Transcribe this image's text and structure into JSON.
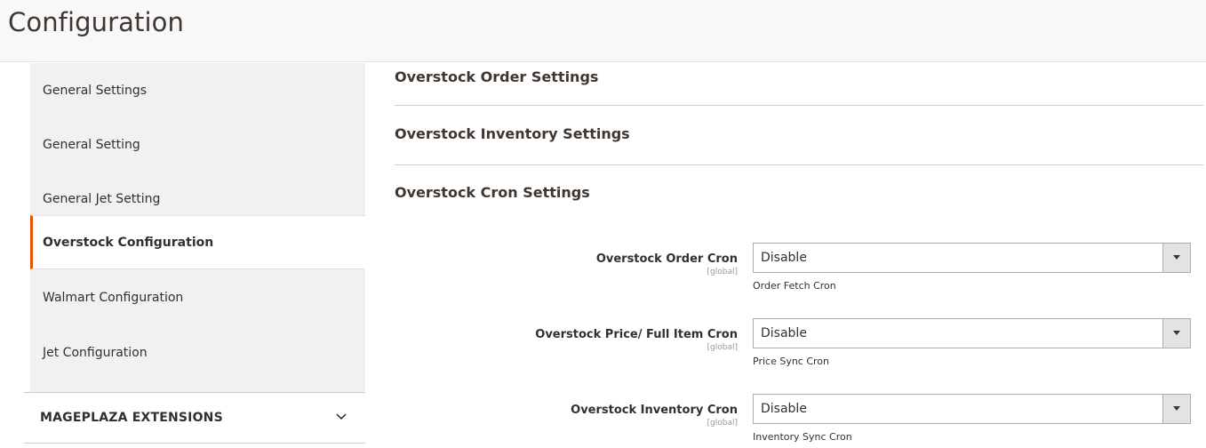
{
  "header": {
    "title": "Configuration"
  },
  "sidebar": {
    "items": [
      {
        "label": "General Settings"
      },
      {
        "label": "General Setting"
      },
      {
        "label": "General Jet Setting"
      },
      {
        "label": "Overstock Configuration",
        "active": true
      },
      {
        "label": "Walmart Configuration"
      },
      {
        "label": "Jet Configuration"
      }
    ],
    "section": {
      "label": "MAGEPLAZA EXTENSIONS",
      "icon": "chevron-down-icon"
    }
  },
  "main": {
    "sections": [
      {
        "title": "Overstock Order Settings"
      },
      {
        "title": "Overstock Inventory Settings"
      },
      {
        "title": "Overstock Cron Settings"
      }
    ],
    "fields": [
      {
        "label": "Overstock Order Cron",
        "scope": "[global]",
        "value": "Disable",
        "note": "Order Fetch Cron"
      },
      {
        "label": "Overstock Price/ Full Item Cron",
        "scope": "[global]",
        "value": "Disable",
        "note": "Price Sync Cron"
      },
      {
        "label": "Overstock Inventory Cron",
        "scope": "[global]",
        "value": "Disable",
        "note": "Inventory Sync Cron"
      }
    ]
  },
  "colors": {
    "accent": "#eb5202",
    "title": "#41362f",
    "sidebar_bg": "#f1f1f1"
  }
}
